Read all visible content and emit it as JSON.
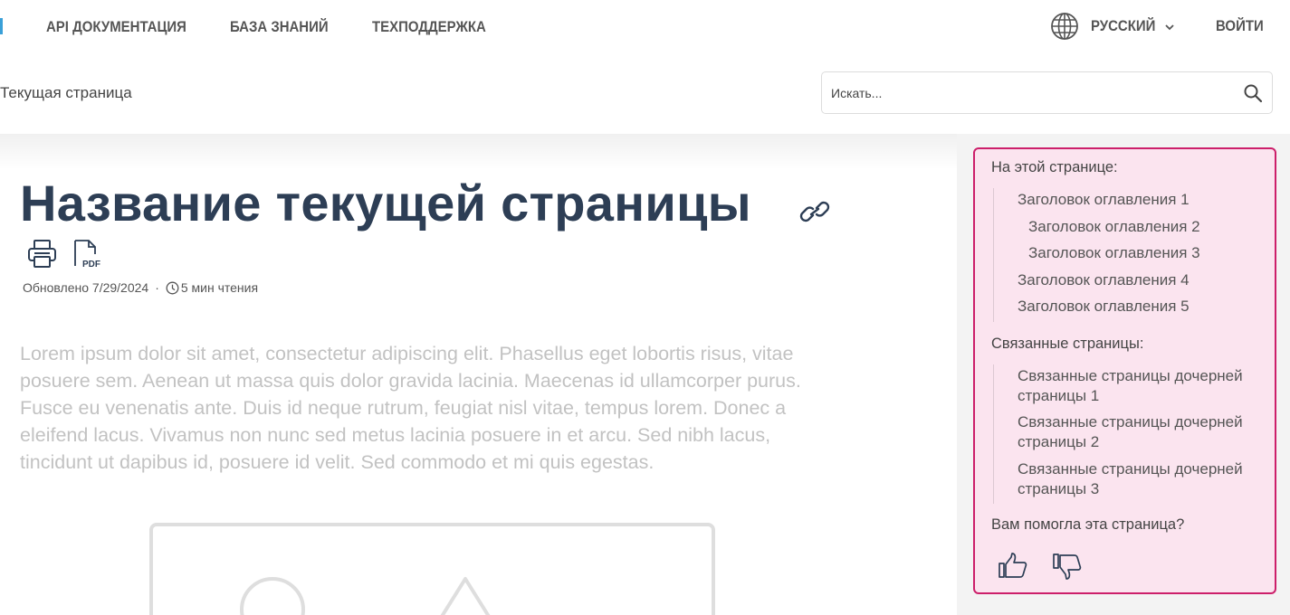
{
  "nav": {
    "links": [
      "API ДОКУМЕНТАЦИЯ",
      "БАЗА ЗНАНИЙ",
      "ТЕХПОДДЕРЖКА"
    ],
    "language": "РУССКИЙ",
    "login": "ВОЙТИ",
    "accent_color": "#3aa0d8"
  },
  "breadcrumb": "Текущая страница",
  "search": {
    "placeholder": "Искать..."
  },
  "page": {
    "title": "Название текущей страницы",
    "updated": "Обновлено 7/29/2024",
    "separator": "·",
    "read_time": "5 мин чтения",
    "pdf_label": "PDF",
    "body": "Lorem ipsum dolor sit amet, consectetur adipiscing elit. Phasellus eget lobortis risus, vitae posuere sem. Aenean ut massa quis dolor gravida lacinia. Maecenas id ullamcorper purus. Fusce eu venenatis ante. Duis id neque rutrum, feugiat nisl vitae, tempus lorem. Donec a eleifend lacus. Vivamus non nunc sed metus lacinia posuere in et arcu. Sed nibh lacus, tincidunt ut dapibus id, posuere id velit. Sed commodo et mi quis egestas.",
    "title_color": "#2d3e55"
  },
  "sidebar": {
    "toc_title": "На этой странице:",
    "toc": [
      "Заголовок оглавления 1",
      "Заголовок оглавления 2",
      "Заголовок оглавления 3",
      "Заголовок оглавления 4",
      "Заголовок оглавления 5"
    ],
    "related_title": "Связанные страницы:",
    "related": [
      "Связанные страницы дочерней страницы 1",
      "Связанные страницы дочерней страницы 2",
      "Связанные страницы дочерней страницы 3"
    ],
    "feedback_title": "Вам помогла эта страница?",
    "border_color": "#cc1f6a",
    "background_color": "#fbe4ef"
  }
}
